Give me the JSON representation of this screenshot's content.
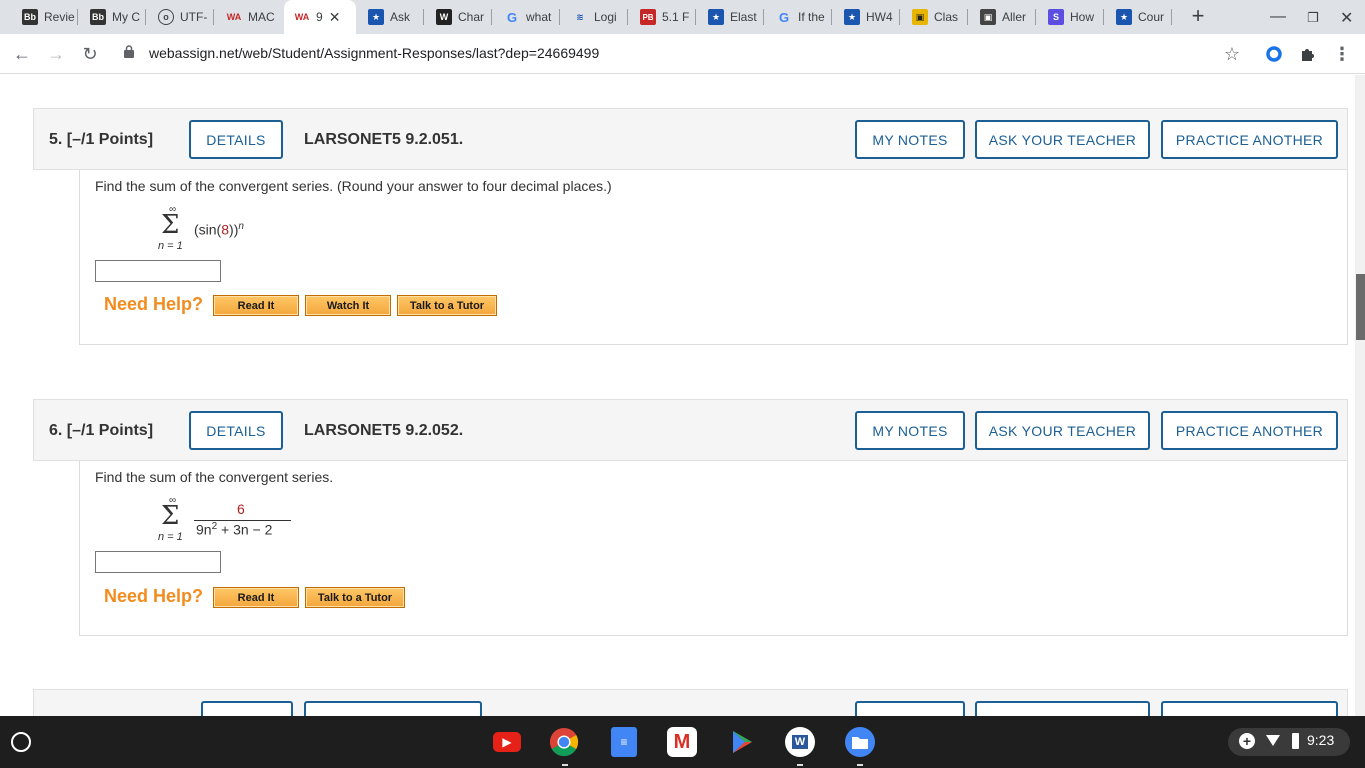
{
  "browser": {
    "tabs": [
      {
        "label": "Revie",
        "icon": "Bb"
      },
      {
        "label": "My C",
        "icon": "Bb"
      },
      {
        "label": "UTF-",
        "icon": "o"
      },
      {
        "label": "MAC",
        "icon": "WA"
      },
      {
        "label": "9",
        "icon": "WA",
        "active": true
      },
      {
        "label": "Ask",
        "icon": "★"
      },
      {
        "label": "Char",
        "icon": "W"
      },
      {
        "label": "what",
        "icon": "G"
      },
      {
        "label": "Logi",
        "icon": "≋"
      },
      {
        "label": "5.1 F",
        "icon": "PB"
      },
      {
        "label": "Elast",
        "icon": "★"
      },
      {
        "label": "If the",
        "icon": "G"
      },
      {
        "label": "HW4",
        "icon": "★"
      },
      {
        "label": "Clas",
        "icon": "▣"
      },
      {
        "label": "Aller",
        "icon": "▣"
      },
      {
        "label": "How",
        "icon": "S"
      },
      {
        "label": "Cour",
        "icon": "★"
      }
    ],
    "url": "webassign.net/web/Student/Assignment-Responses/last?dep=24669499"
  },
  "questions": [
    {
      "title": "5.  [–/1 Points]",
      "details": "DETAILS",
      "code": "LARSONET5 9.2.051.",
      "my_notes": "MY NOTES",
      "ask_teacher": "ASK YOUR TEACHER",
      "practice": "PRACTICE ANOTHER",
      "prompt": "Find the sum of the convergent series. (Round your answer to four decimal places.)",
      "sum_top": "∞",
      "sum_bottom": "n = 1",
      "expr_pre": "(sin(",
      "expr_red": "8",
      "expr_post": "))",
      "expr_exp": "n",
      "need_help": "Need Help?",
      "help_buttons": [
        "Read It",
        "Watch It",
        "Talk to a Tutor"
      ]
    },
    {
      "title": "6.  [–/1 Points]",
      "details": "DETAILS",
      "code": "LARSONET5 9.2.052.",
      "my_notes": "MY NOTES",
      "ask_teacher": "ASK YOUR TEACHER",
      "practice": "PRACTICE ANOTHER",
      "prompt": "Find the sum of the convergent series.",
      "sum_top": "∞",
      "sum_bottom": "n = 1",
      "numerator": "6",
      "denominator_a": "9n",
      "denominator_exp": "2",
      "denominator_b": " + 3n − 2",
      "need_help": "Need Help?",
      "help_buttons": [
        "Read It",
        "Talk to a Tutor"
      ]
    }
  ],
  "taskbar": {
    "time": "9:23",
    "apps": [
      "YouTube",
      "Chrome",
      "Docs",
      "Gmail",
      "Play Store",
      "Word",
      "Files"
    ]
  },
  "colors": {
    "accent": "#1b5f95",
    "need_help": "#f28c1e",
    "highlight_red": "#b22222"
  }
}
